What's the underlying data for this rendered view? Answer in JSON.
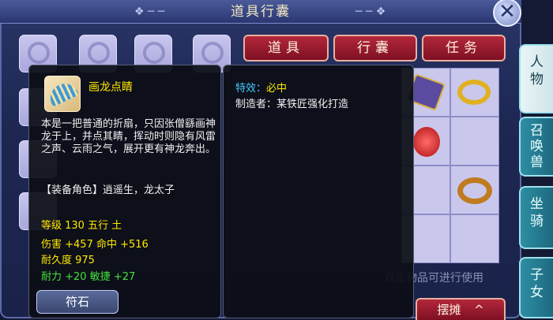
{
  "window": {
    "title": "道具行囊",
    "close_label": "✕"
  },
  "tabs": [
    {
      "label": "道具"
    },
    {
      "label": "行囊"
    },
    {
      "label": "任务"
    }
  ],
  "side_tabs": [
    {
      "label": "人\n物"
    },
    {
      "label": "召\n唤\n兽"
    },
    {
      "label": "坐\n骑"
    },
    {
      "label": "子\n女"
    }
  ],
  "item": {
    "name": "画龙点睛",
    "description": "本是一把普通的折扇，只因张僧繇画神龙于上，并点其睛，挥动时则隐有风雷之声、云雨之气，展开更有神龙奔出。",
    "equip_role": "【装备角色】逍遥生，龙太子",
    "stats": {
      "level_line": "等级 130  五行 土",
      "attack_line": "伤害 +457 命中 +516",
      "durability_line": "耐久度 975",
      "bonus_line": "耐力 +20 敏捷 +27"
    },
    "rune_button": "符石",
    "effect_label": "特效：",
    "effect_value": "必中",
    "maker": "制造者：某铁匠强化打造"
  },
  "hint_text": "双击物品可进行使用",
  "bottom": {
    "stall_button": "摆摊",
    "arrow": "^"
  },
  "colors": {
    "tab_red": "#9e1a2e",
    "item_yellow": "#ffe800",
    "bonus_green": "#44e33a"
  }
}
